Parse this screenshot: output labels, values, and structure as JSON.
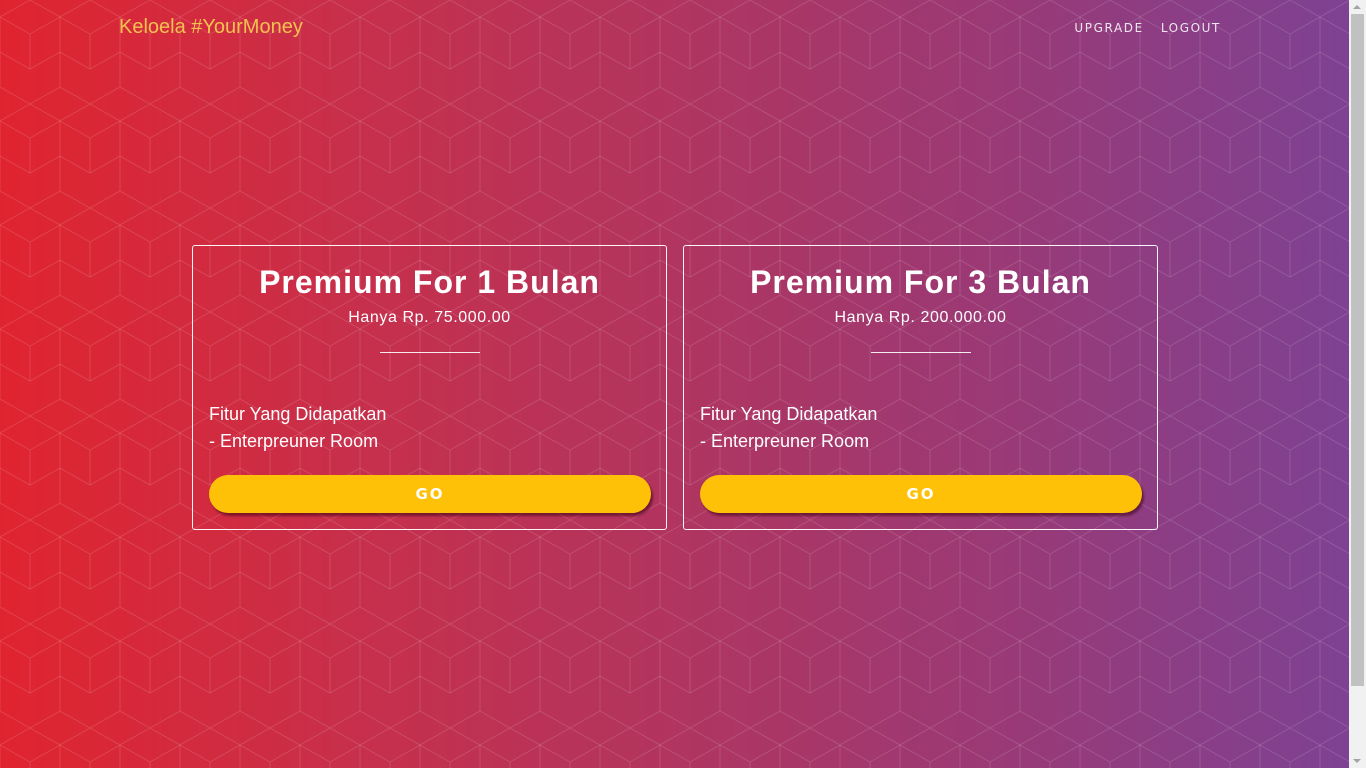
{
  "navbar": {
    "brand": "Keloela #YourMoney",
    "links": [
      "UPGRADE",
      "LOGOUT"
    ]
  },
  "plans": [
    {
      "title": "Premium For 1 Bulan",
      "price": "Hanya Rp. 75.000.00",
      "features_title": "Fitur Yang Didapatkan",
      "features": [
        "- Enterpreuner Room"
      ],
      "button": "GO"
    },
    {
      "title": "Premium For 3 Bulan",
      "price": "Hanya Rp. 200.000.00",
      "features_title": "Fitur Yang Didapatkan",
      "features": [
        "- Enterpreuner Room"
      ],
      "button": "GO"
    }
  ],
  "colors": {
    "gradient_start": "#e0242f",
    "gradient_end": "#7c4294",
    "brand": "#f2c14e",
    "button": "#ffc107"
  }
}
